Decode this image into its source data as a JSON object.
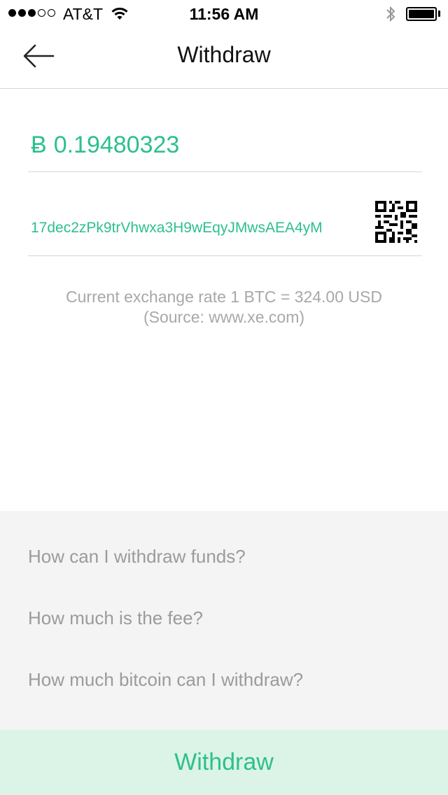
{
  "status_bar": {
    "carrier": "AT&T",
    "time": "11:56 AM",
    "signal_filled": 3,
    "signal_total": 5
  },
  "nav": {
    "title": "Withdraw",
    "back_icon": "arrow-left-icon"
  },
  "amount": {
    "currency_symbol": "Ƀ",
    "value": "0.19480323"
  },
  "address": {
    "value": "17dec2zPk9trVhwxa3H9wEqyJMwsAEA4yM",
    "qr_icon": "qr-code-icon"
  },
  "exchange": {
    "rate_text": "Current exchange rate 1 BTC = 324.00 USD",
    "source_text": "(Source: www.xe.com)"
  },
  "faq": {
    "items": [
      {
        "label": "How can I withdraw funds?"
      },
      {
        "label": "How much is the fee?"
      },
      {
        "label": "How much bitcoin can I withdraw?"
      }
    ]
  },
  "withdraw_button": {
    "label": "Withdraw"
  },
  "colors": {
    "accent": "#2dc08c",
    "button_bg": "#dcf3e8",
    "faq_bg": "#f4f4f4",
    "muted_text": "#9b9b9b"
  }
}
